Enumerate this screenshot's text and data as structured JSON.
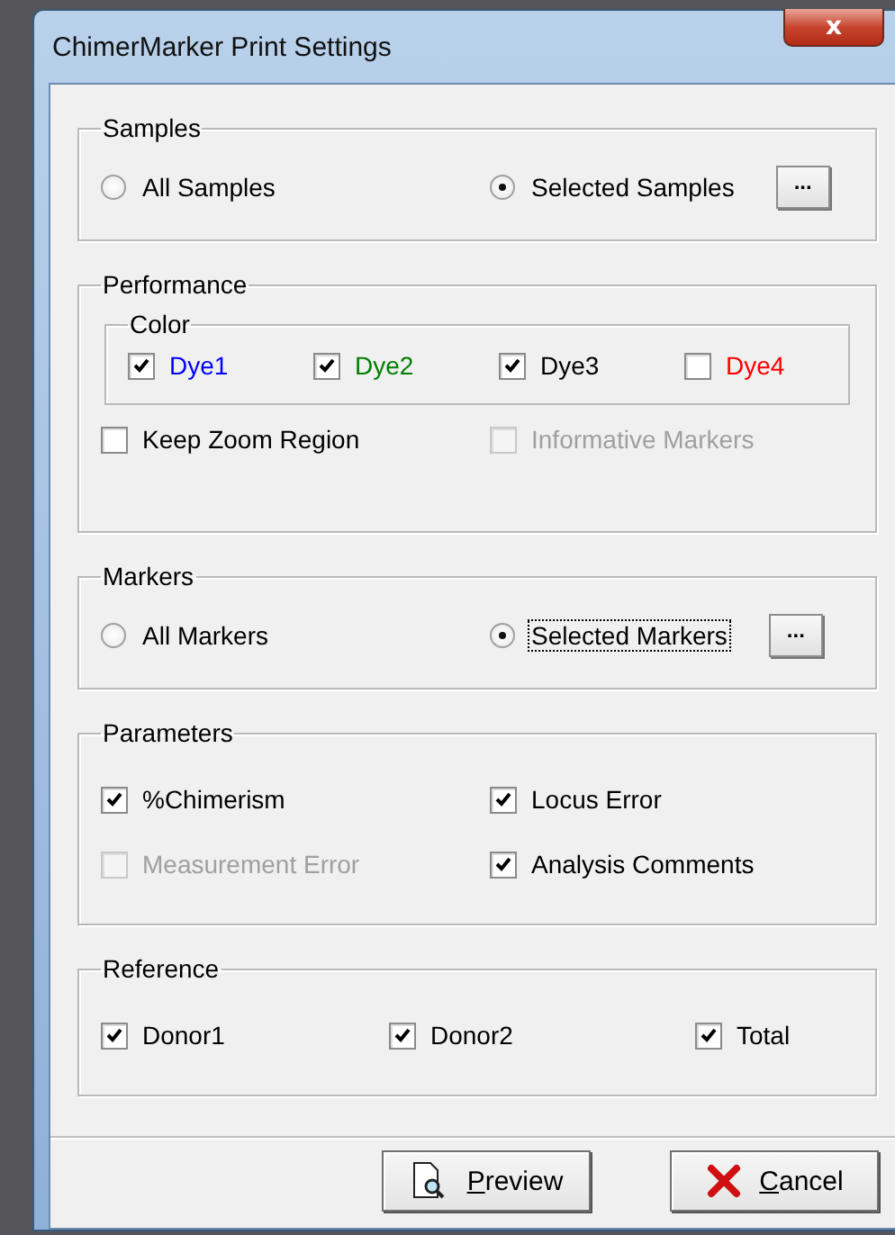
{
  "window": {
    "title": "ChimerMarker Print Settings",
    "close_glyph": "x"
  },
  "groups": [
    {
      "kind": "radio",
      "title": "Samples",
      "options": [
        {
          "label": "All Samples",
          "selected": false,
          "focused": false
        },
        {
          "label": "Selected Samples",
          "selected": true,
          "focused": false
        }
      ],
      "browse_button": "..."
    },
    {
      "kind": "performance",
      "title": "Performance",
      "color_group": {
        "title": "Color",
        "dyes": [
          {
            "label": "Dye1",
            "checked": true,
            "color": "#0000ff"
          },
          {
            "label": "Dye2",
            "checked": true,
            "color": "#008000"
          },
          {
            "label": "Dye3",
            "checked": true,
            "color": "#000000"
          },
          {
            "label": "Dye4",
            "checked": false,
            "color": "#ff0000"
          }
        ]
      },
      "rows": [
        [
          {
            "label": "Keep Zoom Region",
            "checked": false,
            "disabled": false
          },
          {
            "label": "Informative Markers",
            "checked": false,
            "disabled": true
          }
        ]
      ]
    },
    {
      "kind": "radio",
      "title": "Markers",
      "options": [
        {
          "label": "All Markers",
          "selected": false,
          "focused": false
        },
        {
          "label": "Selected Markers",
          "selected": true,
          "focused": true
        }
      ],
      "browse_button": "..."
    },
    {
      "kind": "checks",
      "title": "Parameters",
      "rows": [
        [
          {
            "label": "%Chimerism",
            "checked": true,
            "disabled": false
          },
          {
            "label": "Locus Error",
            "checked": true,
            "disabled": false
          }
        ],
        [
          {
            "label": "Measurement Error",
            "checked": false,
            "disabled": true
          },
          {
            "label": "Analysis Comments",
            "checked": true,
            "disabled": false
          }
        ]
      ]
    },
    {
      "kind": "checks",
      "title": "Reference",
      "rows": [
        [
          {
            "label": "Donor1",
            "checked": true,
            "disabled": false
          },
          {
            "label": "Donor2",
            "checked": true,
            "disabled": false
          },
          {
            "label": "Total",
            "checked": true,
            "disabled": false
          }
        ]
      ]
    }
  ],
  "buttons": [
    {
      "kind": "preview",
      "label": "Preview"
    },
    {
      "kind": "cancel",
      "label": "Cancel"
    }
  ]
}
